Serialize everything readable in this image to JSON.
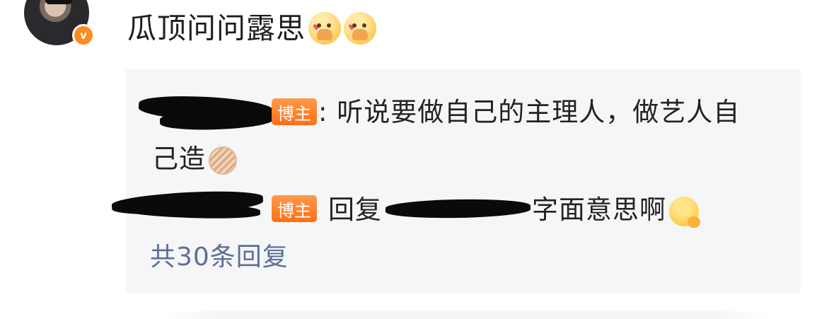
{
  "post": {
    "text": "瓜顶问问露思",
    "emojis": [
      "heart-face-emoji",
      "heart-face-emoji"
    ]
  },
  "replies": [
    {
      "tag": "博主",
      "prefix": ":",
      "text_line1": " 听说要做自己的主理人，做艺人自",
      "text_line2": "己造",
      "emoji": "bubble-emoji"
    },
    {
      "tag": "博主",
      "reply_word": "回复",
      "text": "字面意思啊",
      "emoji": "thinking-emoji"
    }
  ],
  "more_replies_label": "共30条回复",
  "colors": {
    "reply_background": "#f5f6f8",
    "tag_orange": "#ff7a22",
    "link_blue": "#5e6f95",
    "verified_badge": "#ff8a1f"
  }
}
